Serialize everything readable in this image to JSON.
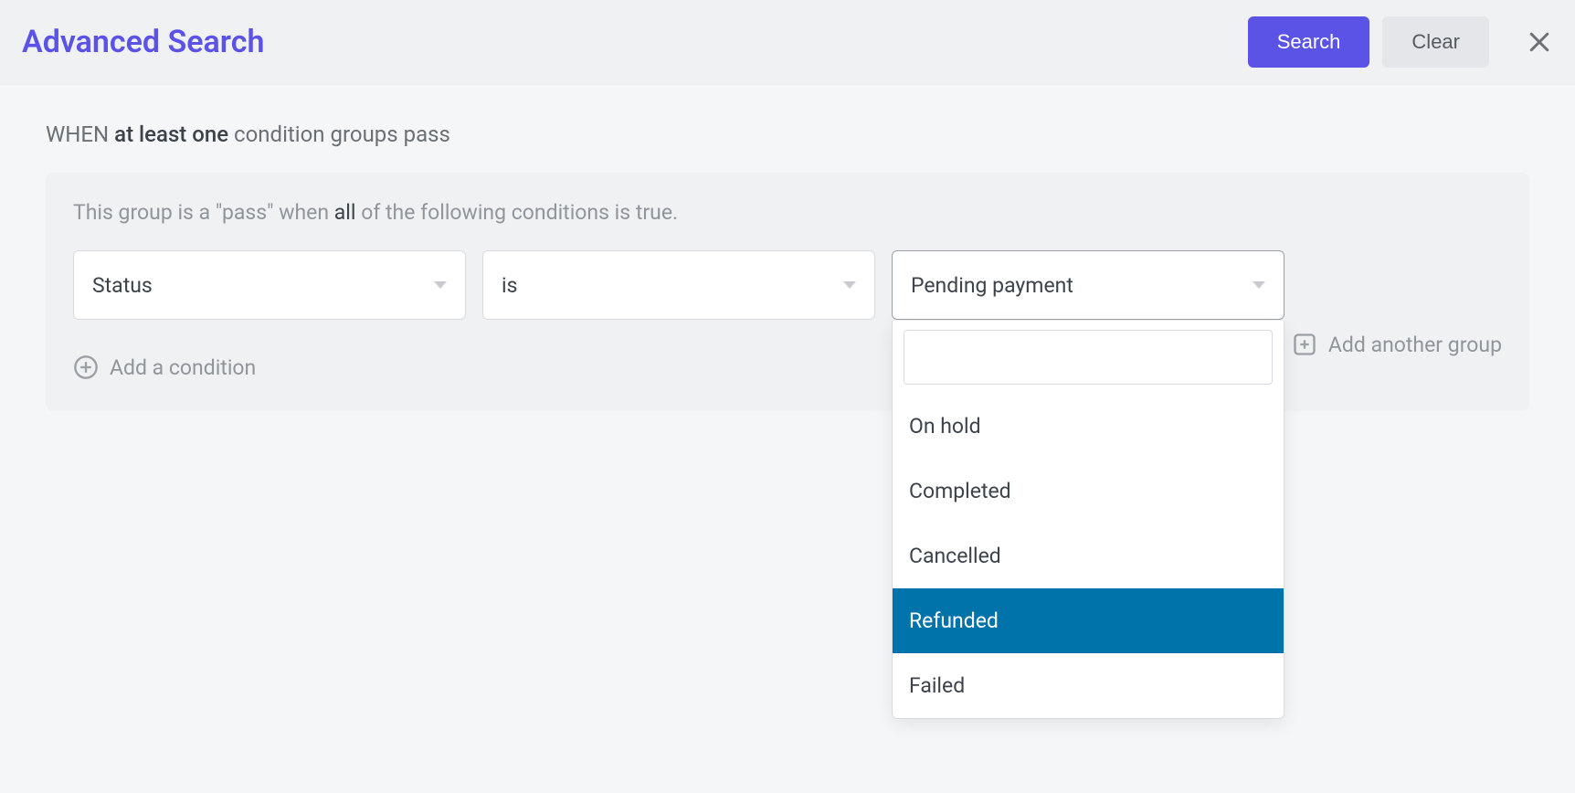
{
  "header": {
    "title": "Advanced Search",
    "search_label": "Search",
    "clear_label": "Clear"
  },
  "rule": {
    "when_prefix": "WHEN",
    "when_mode": "at least one",
    "when_suffix": "condition groups pass"
  },
  "group": {
    "hint_prefix": "This group is a \"pass\" when",
    "hint_mode": "all",
    "hint_suffix": "of the following conditions is true."
  },
  "condition": {
    "field": "Status",
    "operator": "is",
    "value": "Pending payment"
  },
  "dropdown": {
    "search_value": "",
    "options": [
      "On hold",
      "Completed",
      "Cancelled",
      "Refunded",
      "Failed"
    ],
    "highlighted_index": 3
  },
  "actions": {
    "add_condition_label": "Add a condition",
    "add_group_label": "Add another group"
  }
}
